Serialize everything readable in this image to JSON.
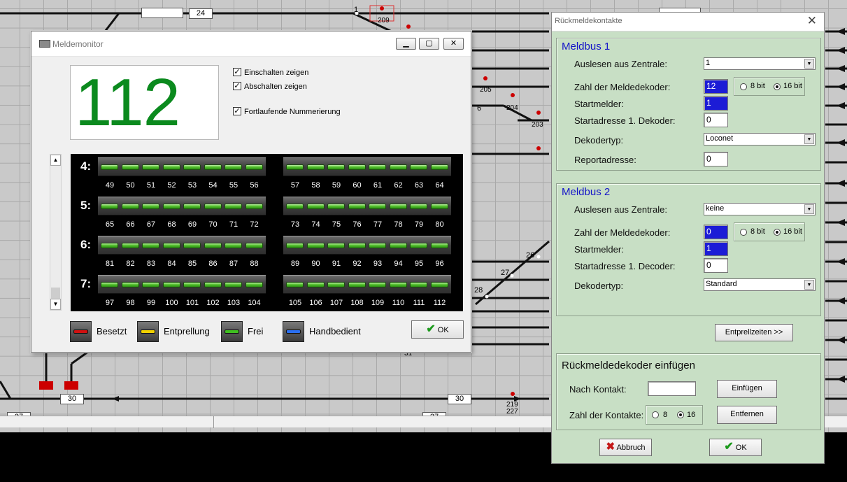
{
  "plan": {
    "labels": [
      "24",
      "30",
      "30",
      "27",
      "27"
    ],
    "numbers": [
      "1",
      "209",
      "205",
      "204",
      "6",
      "203",
      "26",
      "27",
      "28",
      "219",
      "227",
      "31"
    ]
  },
  "monitor": {
    "title": "Meldemonitor",
    "big_number": "112",
    "options": [
      {
        "label": "Einschalten zeigen",
        "checked": true
      },
      {
        "label": "Abschalten zeigen",
        "checked": true
      },
      {
        "label": "Fortlaufende Nummerierung",
        "checked": true
      }
    ],
    "rows": [
      {
        "label": "4:",
        "left": [
          "49",
          "50",
          "51",
          "52",
          "53",
          "54",
          "55",
          "56"
        ],
        "right": [
          "57",
          "58",
          "59",
          "60",
          "61",
          "62",
          "63",
          "64"
        ]
      },
      {
        "label": "5:",
        "left": [
          "65",
          "66",
          "67",
          "68",
          "69",
          "70",
          "71",
          "72"
        ],
        "right": [
          "73",
          "74",
          "75",
          "76",
          "77",
          "78",
          "79",
          "80"
        ]
      },
      {
        "label": "6:",
        "left": [
          "81",
          "82",
          "83",
          "84",
          "85",
          "86",
          "87",
          "88"
        ],
        "right": [
          "89",
          "90",
          "91",
          "92",
          "93",
          "94",
          "95",
          "96"
        ]
      },
      {
        "label": "7:",
        "left": [
          "97",
          "98",
          "99",
          "100",
          "101",
          "102",
          "103",
          "104"
        ],
        "right": [
          "105",
          "106",
          "107",
          "108",
          "109",
          "110",
          "111",
          "112"
        ]
      }
    ],
    "led_state": "Frei",
    "legend": [
      {
        "label": "Besetzt",
        "color": "#d01010"
      },
      {
        "label": "Entprellung",
        "color": "#f0d000"
      },
      {
        "label": "Frei",
        "color": "#3fbf20"
      },
      {
        "label": "Handbedient",
        "color": "#2a6ff0"
      }
    ],
    "ok_label": "OK"
  },
  "dialog": {
    "title": "Rückmeldekontakte",
    "meldbus1": {
      "title": "Meldbus 1",
      "zentrale_label": "Auslesen aus Zentrale:",
      "zentrale_value": "1",
      "anzahl_label": "Zahl der Meldedekoder:",
      "anzahl_value": "12",
      "bit8": "8 bit",
      "bit16": "16 bit",
      "bit_selected": "16 bit",
      "startmelder_label": "Startmelder:",
      "startmelder_value": "1",
      "startadresse_label": "Startadresse 1. Dekoder:",
      "startadresse_value": "0",
      "typ_label": "Dekodertyp:",
      "typ_value": "Loconet",
      "report_label": "Reportadresse:",
      "report_value": "0"
    },
    "meldbus2": {
      "title": "Meldbus 2",
      "zentrale_label": "Auslesen aus Zentrale:",
      "zentrale_value": "keine",
      "anzahl_label": "Zahl der Meldedekoder:",
      "anzahl_value": "0",
      "bit8": "8 bit",
      "bit16": "16 bit",
      "bit_selected": "16 bit",
      "startmelder_label": "Startmelder:",
      "startmelder_value": "1",
      "startadresse_label": "Startadresse 1. Decoder:",
      "startadresse_value": "0",
      "typ_label": "Dekodertyp:",
      "typ_value": "Standard"
    },
    "entprell_button": "Entprellzeiten >>",
    "insert": {
      "title": "Rückmeldedekoder einfügen",
      "nach_label": "Nach Kontakt:",
      "nach_value": "",
      "einfuegen_button": "Einfügen",
      "kontakte_label": "Zahl der Kontakte:",
      "opt8": "8",
      "opt16": "16",
      "selected": "16",
      "entfernen_button": "Entfernen"
    },
    "abbruch_label": "Abbruch",
    "ok_label": "OK"
  }
}
